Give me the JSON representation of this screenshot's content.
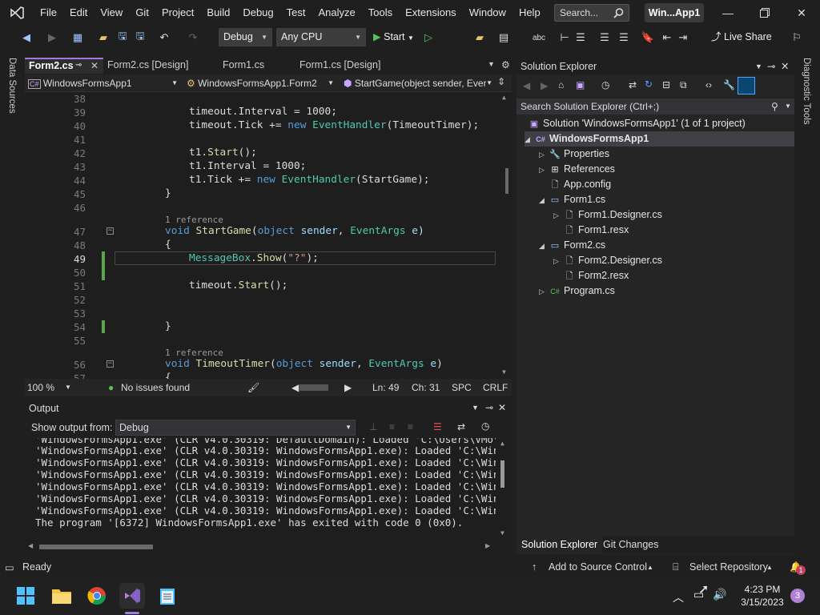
{
  "menu": [
    "File",
    "Edit",
    "View",
    "Git",
    "Project",
    "Build",
    "Debug",
    "Test",
    "Analyze",
    "Tools",
    "Extensions",
    "Window",
    "Help"
  ],
  "search": {
    "label": "Search..."
  },
  "solution_badge": "Win...App1",
  "toolbar": {
    "config": "Debug",
    "platform": "Any CPU",
    "start_label": "Start",
    "live_share": "Live Share"
  },
  "side_left": "Data Sources",
  "side_right": "Diagnostic Tools",
  "editor_tabs": [
    "Form2.cs",
    "Form2.cs [Design]",
    "Form1.cs",
    "Form1.cs [Design]"
  ],
  "navbar": {
    "project": "WindowsFormsApp1",
    "class": "WindowsFormsApp1.Form2",
    "member": "StartGame(object sender, Ever"
  },
  "code": {
    "line_numbers": [
      "38",
      "39",
      "40",
      "41",
      "42",
      "43",
      "44",
      "45",
      "46",
      "47",
      "48",
      "49",
      "50",
      "51",
      "52",
      "53",
      "54",
      "55",
      "56",
      "57"
    ],
    "codelens_1": "1 reference",
    "codelens_2": "1 reference"
  },
  "editor_status": {
    "zoom": "100 %",
    "issues": "No issues found",
    "line": "Ln: 49",
    "col": "Ch: 31",
    "spc": "SPC",
    "eol": "CRLF"
  },
  "output": {
    "title": "Output",
    "show_from_label": "Show output from:",
    "show_from_value": "Debug",
    "lines": [
      "'WindowsFormsApp1.exe' (CLR v4.0.30319: DefaultDomain): Loaded 'C:\\Users\\VMo\\sourc",
      "'WindowsFormsApp1.exe' (CLR v4.0.30319: WindowsFormsApp1.exe): Loaded 'C:\\Windows\\",
      "'WindowsFormsApp1.exe' (CLR v4.0.30319: WindowsFormsApp1.exe): Loaded 'C:\\Windows\\",
      "'WindowsFormsApp1.exe' (CLR v4.0.30319: WindowsFormsApp1.exe): Loaded 'C:\\Windows\\",
      "'WindowsFormsApp1.exe' (CLR v4.0.30319: WindowsFormsApp1.exe): Loaded 'C:\\Windows\\",
      "'WindowsFormsApp1.exe' (CLR v4.0.30319: WindowsFormsApp1.exe): Loaded 'C:\\Windows\\",
      "'WindowsFormsApp1.exe' (CLR v4.0.30319: WindowsFormsApp1.exe): Loaded 'C:\\Windows\\",
      "The program '[6372] WindowsFormsApp1.exe' has exited with code 0 (0x0)."
    ]
  },
  "solution_explorer": {
    "title": "Solution Explorer",
    "search_placeholder": "Search Solution Explorer (Ctrl+;)",
    "tree": [
      {
        "label": "Solution 'WindowsFormsApp1' (1 of 1 project)",
        "icon": "solution-icon",
        "arrow": ""
      },
      {
        "label": "WindowsFormsApp1",
        "icon": "csharp-project-icon",
        "arrow": "◢"
      },
      {
        "label": "Properties",
        "icon": "wrench-icon",
        "arrow": "▷"
      },
      {
        "label": "References",
        "icon": "references-icon",
        "arrow": "▷"
      },
      {
        "label": "App.config",
        "icon": "config-file-icon",
        "arrow": ""
      },
      {
        "label": "Form1.cs",
        "icon": "form-icon",
        "arrow": "◢"
      },
      {
        "label": "Form1.Designer.cs",
        "icon": "code-file-icon",
        "arrow": "▷"
      },
      {
        "label": "Form1.resx",
        "icon": "resx-file-icon",
        "arrow": ""
      },
      {
        "label": "Form2.cs",
        "icon": "form-icon",
        "arrow": "◢"
      },
      {
        "label": "Form2.Designer.cs",
        "icon": "code-file-icon",
        "arrow": "▷"
      },
      {
        "label": "Form2.resx",
        "icon": "resx-file-icon",
        "arrow": ""
      },
      {
        "label": "Program.cs",
        "icon": "csharp-file-icon",
        "arrow": "▷"
      }
    ],
    "tabs": [
      "Solution Explorer",
      "Git Changes"
    ]
  },
  "statusbar": {
    "ready": "Ready",
    "source_control": "Add to Source Control",
    "repo": "Select Repository",
    "notif_count": "1"
  },
  "taskbar": {
    "time": "4:23 PM",
    "date": "3/15/2023",
    "badge": "3"
  },
  "colors": {
    "accent": "#9d7cd8",
    "keyword": "#569cd6",
    "type": "#4ec9b0",
    "method": "#dcdcaa",
    "string": "#d69d85",
    "change_bar": "#57a64a"
  }
}
